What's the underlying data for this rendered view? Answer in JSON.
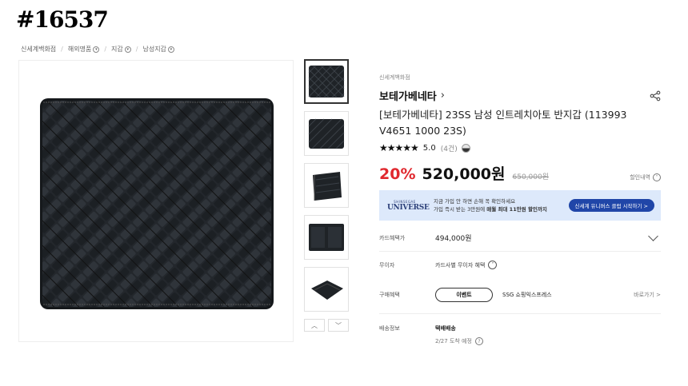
{
  "item_code": "#16537",
  "breadcrumb": [
    {
      "label": "신세계백화점",
      "has_dropdown": false
    },
    {
      "label": "해외명품",
      "has_dropdown": true
    },
    {
      "label": "지갑",
      "has_dropdown": true
    },
    {
      "label": "남성지갑",
      "has_dropdown": true
    }
  ],
  "store": "신세계백화점",
  "brand": "보테가베네타",
  "product_title": "[보테가베네타] 23SS 남성 인트레치아토 반지갑 (113993 V4651 1000 23S)",
  "rating": {
    "stars": "★★★★★",
    "score": "5.0",
    "count": "(4건)"
  },
  "price": {
    "discount": "20%",
    "sale": "520,000원",
    "original": "650,000원",
    "discount_info": "할인내역"
  },
  "banner": {
    "logo_small": "SHINSEGAE",
    "logo_big": "UNIVERSE",
    "line1": "지금 가입 안 하면 손해 꼭 확인하세요",
    "line2_prefix": "가입 즉시 받는 3만원에 ",
    "line2_bold": "매월 최대 11만원 할인까지",
    "button": "신세계 유니버스 클럽 시작하기 >"
  },
  "card_benefit": {
    "label": "카드혜택가",
    "value": "494,000원"
  },
  "installment": {
    "label": "무이자",
    "value": "카드사별 무이자 혜택"
  },
  "purchase_benefit": {
    "label": "구매혜택",
    "pill": "이벤트",
    "ssg": "SSG 쇼핑익스프레스",
    "more": "바로가기 >"
  },
  "shipping": {
    "label": "배송정보",
    "method": "택배배송",
    "date": "2/27 도착 예정"
  },
  "colors": {
    "discount_red": "#e0282e",
    "banner_bg": "#dde9fb",
    "banner_button": "#2046a8"
  }
}
